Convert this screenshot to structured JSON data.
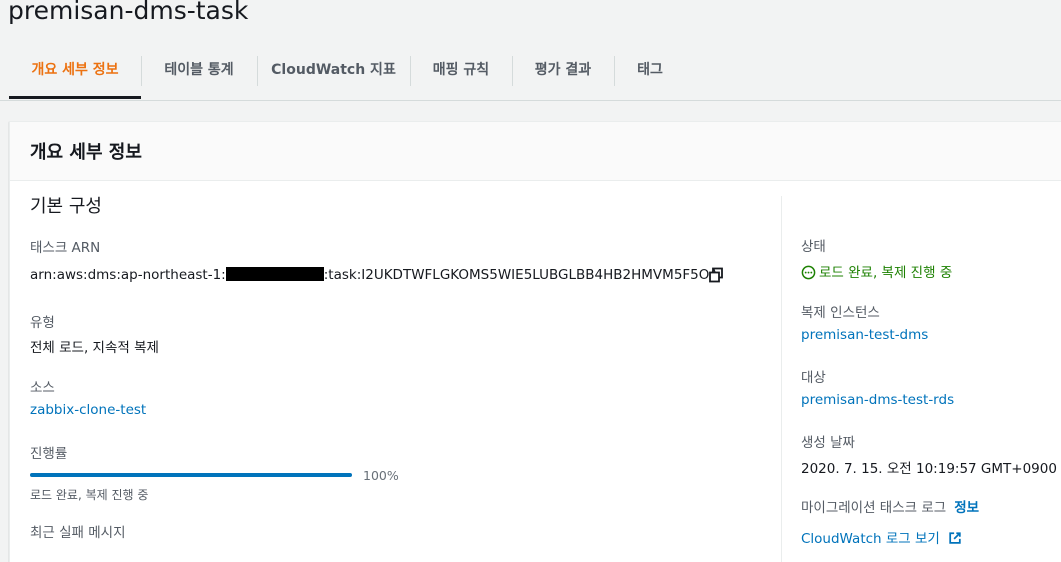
{
  "page": {
    "title": "premisan-dms-task"
  },
  "tabs": [
    {
      "label": "개요 세부 정보",
      "active": true
    },
    {
      "label": "테이블 통계"
    },
    {
      "label": "CloudWatch 지표"
    },
    {
      "label": "매핑 규칙"
    },
    {
      "label": "평가 결과"
    },
    {
      "label": "태그"
    }
  ],
  "panel": {
    "title": "개요 세부 정보",
    "section_title": "기본 구성",
    "left": {
      "arn_label": "태스크 ARN",
      "arn_prefix": "arn:aws:dms:ap-northeast-1:",
      "arn_suffix": ":task:I2UKDTWFLGKOMS5WIE5LUBGLBB4HB2HMVM5F5OA",
      "type_label": "유형",
      "type_value": "전체 로드, 지속적 복제",
      "source_label": "소스",
      "source_value": "zabbix-clone-test",
      "progress_label": "진행률",
      "progress_percent": 100,
      "progress_text": "100%",
      "progress_desc": "로드 완료, 복제 진행 중",
      "last_failure_label": "최근 실패 메시지"
    },
    "right": {
      "status_label": "상태",
      "status_value": "로드 완료, 복제 진행 중",
      "status_icon": "status-in-progress-icon",
      "instance_label": "복제 인스턴스",
      "instance_value": "premisan-test-dms",
      "target_label": "대상",
      "target_value": "premisan-dms-test-rds",
      "created_label": "생성 날짜",
      "created_value": "2020. 7. 15. 오전 10:19:57 GMT+0900",
      "migration_log_label": "마이그레이션 태스크 로그",
      "info_link": "정보",
      "cloudwatch_link": "CloudWatch 로그 보기"
    }
  },
  "colors": {
    "accent": "#ec7211",
    "link": "#0073bb",
    "success": "#1d8102",
    "text": "#16191f",
    "muted": "#545b64"
  }
}
